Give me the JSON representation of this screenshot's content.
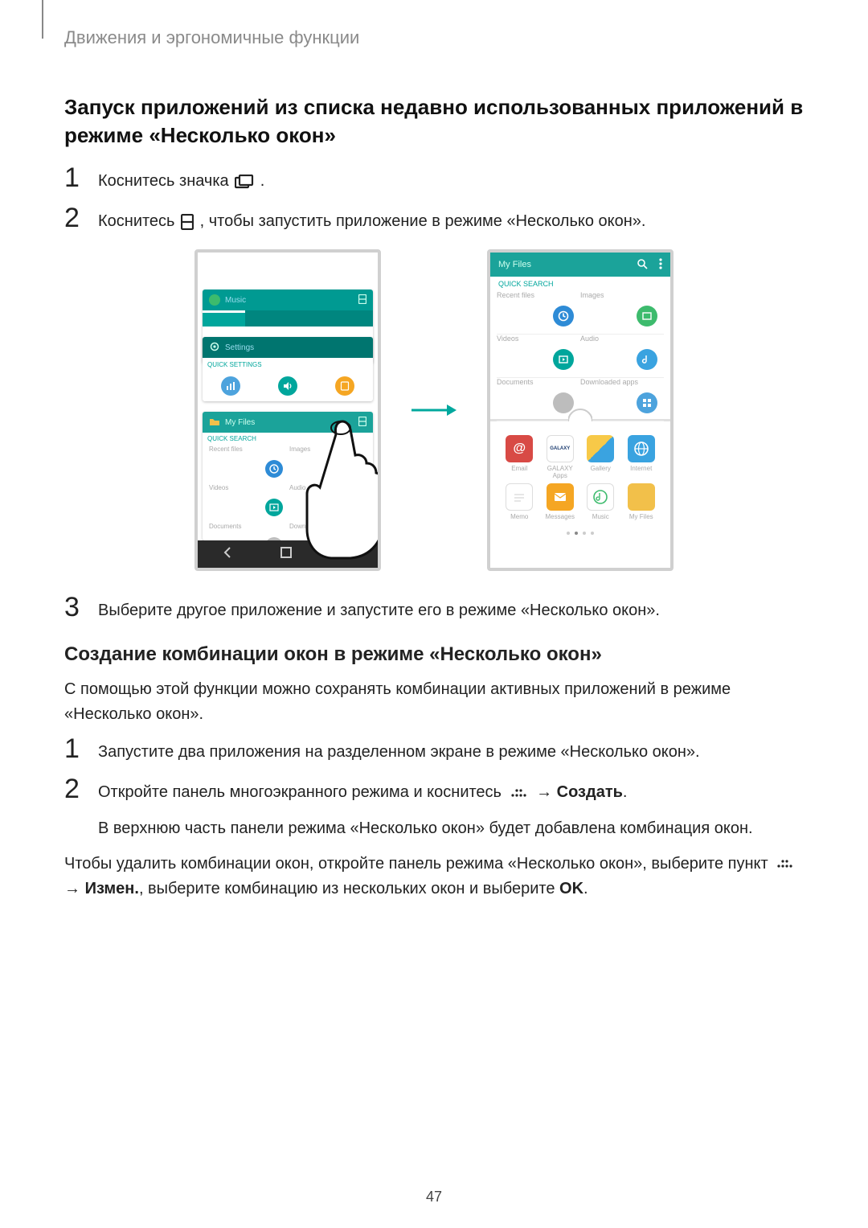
{
  "running_head": "Движения и эргономичные функции",
  "section_title": "Запуск приложений из списка недавно использованных приложений в режиме «Несколько окон»",
  "steps_a": {
    "s1_pre": "Коснитесь значка ",
    "s1_post": ".",
    "s2_pre": "Коснитесь ",
    "s2_post": ", чтобы запустить приложение в режиме «Несколько окон».",
    "s3": "Выберите другое приложение и запустите его в режиме «Несколько окон»."
  },
  "icons": {
    "recent": "recent-apps-icon",
    "multiwindow": "multi-window-icon",
    "more_dots": "more-options-dots-icon"
  },
  "phone1": {
    "music_label": "Music",
    "settings_label": "Settings",
    "quick_settings": "QUICK SETTINGS",
    "my_files": "My Files",
    "quick_search": "QUICK SEARCH",
    "cells": {
      "recent": "Recent files",
      "images": "Images",
      "videos": "Videos",
      "audio": "Audio",
      "documents": "Documents",
      "downloaded": "Downloaded"
    }
  },
  "phone2": {
    "title": "My Files",
    "quick_search": "QUICK SEARCH",
    "cells": {
      "recent": "Recent files",
      "images": "Images",
      "videos": "Videos",
      "audio": "Audio",
      "documents": "Documents",
      "downloaded_apps": "Downloaded apps"
    },
    "apps_row1": [
      "Email",
      "GALAXY Apps",
      "Gallery",
      "Internet"
    ],
    "apps_row2": [
      "Memo",
      "Messages",
      "Music",
      "My Files"
    ],
    "galaxy_logo": "GALAXY"
  },
  "subsection_title": "Создание комбинации окон в режиме «Несколько окон»",
  "para1": "С помощью этой функции можно сохранять комбинации активных приложений в режиме «Несколько окон».",
  "steps_b": {
    "s1": "Запустите два приложения на разделенном экране в режиме «Несколько окон».",
    "s2_pre": "Откройте панель многоэкранного режима и коснитесь ",
    "s2_mid": " → ",
    "s2_bold": "Создать",
    "s2_post": ".",
    "s2_line2": "В верхнюю часть панели режима «Несколько окон» будет добавлена комбинация окон."
  },
  "para_delete_pre": "Чтобы удалить комбинации окон, откройте панель режима «Несколько окон», выберите пункт ",
  "para_delete_mid": " → ",
  "para_delete_bold1": "Измен.",
  "para_delete_after": ", выберите комбинацию из нескольких окон и выберите ",
  "para_delete_bold2": "OK",
  "para_delete_end": ".",
  "page_number": "47"
}
